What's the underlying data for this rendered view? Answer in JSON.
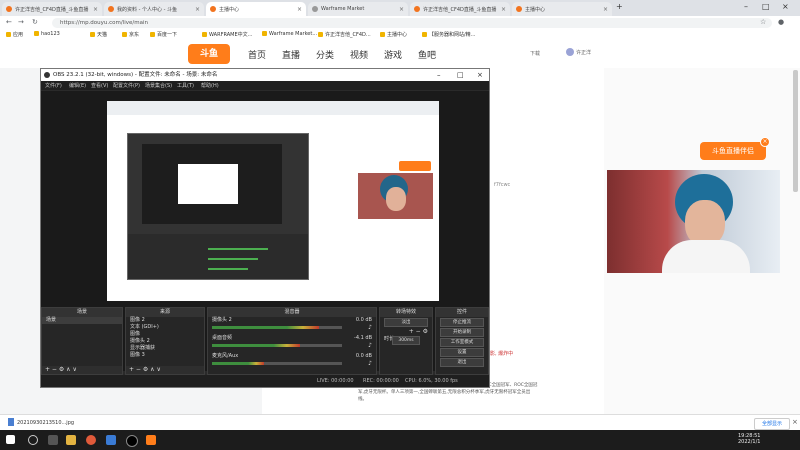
{
  "browser": {
    "tabs": [
      {
        "label": "许正洋吉他_CF4D直播_斗鱼直播"
      },
      {
        "label": "我的资料 - 个人中心 - 斗鱼"
      },
      {
        "label": "主播中心"
      },
      {
        "label": "Warframe Market"
      },
      {
        "label": "许正洋吉他_CF4D直播_斗鱼直播"
      },
      {
        "label": "主播中心"
      }
    ],
    "url": "https://mp.douyu.com/live/main",
    "bookmarks": [
      "应用",
      "hao123",
      "天猫",
      "京东",
      "百度一下",
      "WARFRAME中文...",
      "Warframe Market...",
      "许正洋吉他_CF4D...",
      "主播中心",
      "【服务器和网站/精..."
    ]
  },
  "douyu": {
    "logo": "斗鱼",
    "nav": [
      "首页",
      "直播",
      "分类",
      "视频",
      "游戏",
      "鱼吧"
    ],
    "download": "下载",
    "user": "许正洋"
  },
  "obs": {
    "title": "OBS 23.2.1 (32-bit, windows) - 配置文件: 未命名 - 场景: 未命名",
    "menu": [
      "文件(F)",
      "编辑(E)",
      "查看(V)",
      "配置文件(P)",
      "场景集合(S)",
      "工具(T)",
      "帮助(H)"
    ],
    "scenes_header": "场景",
    "scenes": [
      "场景"
    ],
    "sources_header": "来源",
    "sources": [
      "图像 2",
      "文本 (GDI+)",
      "图像",
      "摄像头 2",
      "显示器捕获",
      "图像 3"
    ],
    "mixer_header": "混音器",
    "mixer": [
      {
        "name": "摄像头 2",
        "db": "0.0 dB",
        "level": 0.82
      },
      {
        "name": "桌面音频",
        "db": "-4.1 dB",
        "level": 0.68
      },
      {
        "name": "麦克风/Aux",
        "db": "0.0 dB",
        "level": 0.4
      }
    ],
    "transitions_header": "转场特效",
    "transition": "淡出",
    "duration_label": "时长",
    "duration": "300ms",
    "controls_header": "控件",
    "controls": [
      "停止推流",
      "开始录制",
      "工作室模式",
      "设置",
      "退出"
    ],
    "status": {
      "live": "LIVE: 00:00:00",
      "rec": "REC: 00:00:00",
      "cpu": "CPU: 6.0%, 30.00 fps"
    },
    "foot_symbols": "+ − ⚙ ∧ ∨"
  },
  "page": {
    "badge": "斗鱼直播伴侣",
    "tag": "影, 爆炸中",
    "text": "斯沃斯拉尔跨FY战队队长,斗鱼成员。签约加斗鱼首位大主播。ROC全国冠军、ROC全国冠军,虎牙无限杯。单人三项第一,全国蝉联第五,无限总积分杯季军,虎牙无限杯冠军全员出线。",
    "side_note": "f7fcwc"
  },
  "download_bar": {
    "file": "20210930213510...jpg",
    "show_all": "全部显示"
  },
  "taskbar": {
    "time": "19:28:51",
    "date": "2022/1/1"
  },
  "colors": {
    "douyu_orange": "#ff7d1a",
    "obs_dark": "#2a2a2a"
  }
}
